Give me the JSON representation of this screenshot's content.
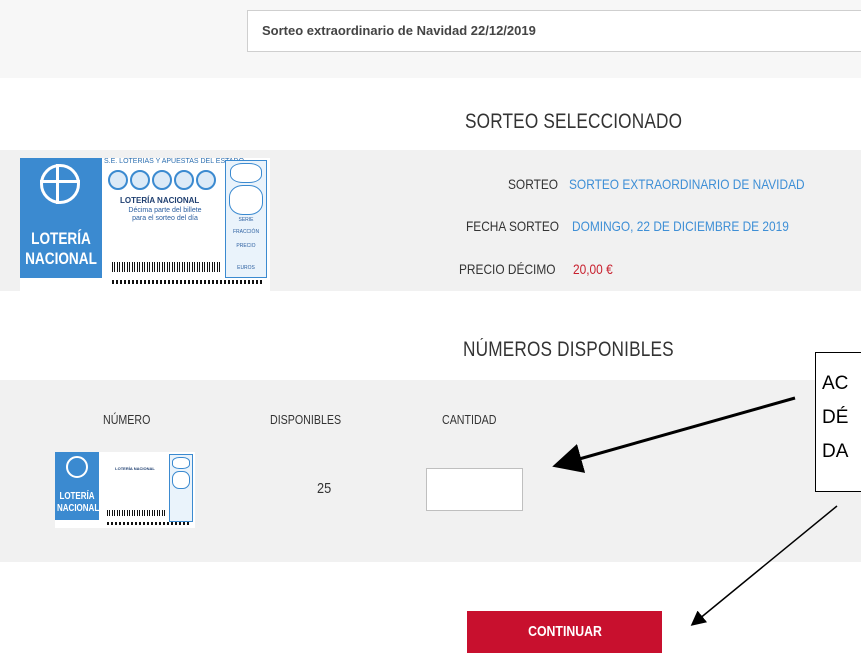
{
  "draw_select": {
    "value": "Sorteo extraordinario de Navidad 22/12/2019"
  },
  "selected": {
    "title": "SORTEO SELECCIONADO",
    "rows": [
      {
        "label": "SORTEO",
        "value": "SORTEO EXTRAORDINARIO DE NAVIDAD"
      },
      {
        "label": "FECHA SORTEO",
        "value": "DOMINGO, 22 DE DICIEMBRE DE 2019"
      },
      {
        "label": "PRECIO DÉCIMO",
        "value": "20,00 €"
      }
    ]
  },
  "ticket": {
    "brand_line1": "LOTERÍA",
    "brand_line2": "NACIONAL",
    "issuer": "S.E. LOTERÍAS Y APUESTAS DEL ESTADO",
    "name": "LOTERÍA NACIONAL",
    "desc_line1": "Décima parte del billete",
    "desc_line2": "para el sorteo del día",
    "side_labels": [
      "SERIE",
      "FRACCIÓN",
      "PRECIO",
      "EUROS"
    ]
  },
  "available": {
    "title": "NÚMEROS DISPONIBLES",
    "columns": {
      "number": "NÚMERO",
      "available": "DISPONIBLES",
      "quantity": "CANTIDAD"
    },
    "row": {
      "available_count": "25",
      "quantity_value": ""
    }
  },
  "actions": {
    "continue_label": "CONTINUAR"
  },
  "annotation": {
    "lines": [
      "AC",
      "DÉ",
      "DA"
    ]
  },
  "colors": {
    "accent_blue": "#3e8fd6",
    "price_red": "#c8202e",
    "button_red": "#c8102e"
  }
}
